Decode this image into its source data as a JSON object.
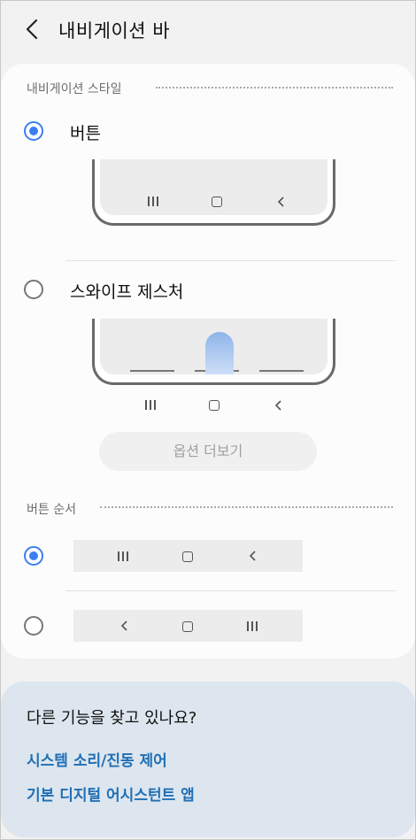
{
  "header": {
    "title": "내비게이션 바",
    "back_icon": "chevron-left-icon"
  },
  "style_section": {
    "label": "내비게이션 스타일",
    "options": [
      {
        "label": "버튼",
        "selected": true
      },
      {
        "label": "스와이프 제스처",
        "selected": false
      }
    ],
    "more_button": "옵션 더보기"
  },
  "order_section": {
    "label": "버튼 순서",
    "options": [
      {
        "selected": true,
        "icons": [
          "recents-icon",
          "home-icon",
          "back-icon"
        ]
      },
      {
        "selected": false,
        "icons": [
          "back-icon",
          "home-icon",
          "recents-icon"
        ]
      }
    ]
  },
  "related": {
    "title": "다른 기능을 찾고 있나요?",
    "links": [
      "시스템 소리/진동 제어",
      "기본 디지털 어시스턴트 앱"
    ]
  },
  "colors": {
    "accent": "#3a7ff0",
    "link": "#1f6fb5",
    "background": "#f2f2f2",
    "card": "#fcfcfc",
    "related_card": "#dde6ee"
  }
}
